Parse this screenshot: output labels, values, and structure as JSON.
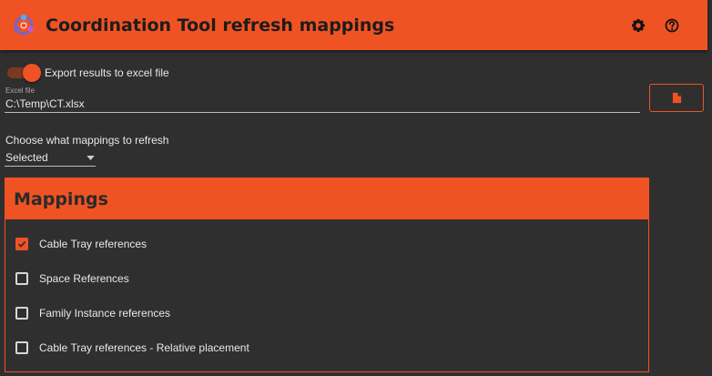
{
  "header": {
    "title": "Coordination Tool refresh mappings",
    "icons": [
      "app-logo-icon",
      "gear-icon",
      "help-icon"
    ]
  },
  "export": {
    "toggle_on": true,
    "label": "Export results to excel file"
  },
  "excel_file": {
    "label": "Excel file",
    "value": "C:\\Temp\\CT.xlsx",
    "button_icon": "file-icon"
  },
  "refresh": {
    "label": "Choose what mappings to refresh",
    "selected": "Selected"
  },
  "mappings": {
    "title": "Mappings",
    "items": [
      {
        "label": "Cable Tray references",
        "checked": true
      },
      {
        "label": "Space References",
        "checked": false
      },
      {
        "label": "Family Instance references",
        "checked": false
      },
      {
        "label": "Cable Tray references - Relative placement",
        "checked": false
      }
    ]
  },
  "colors": {
    "accent": "#f05323",
    "background": "#2f2f2f",
    "text": "#e8e8e8"
  }
}
